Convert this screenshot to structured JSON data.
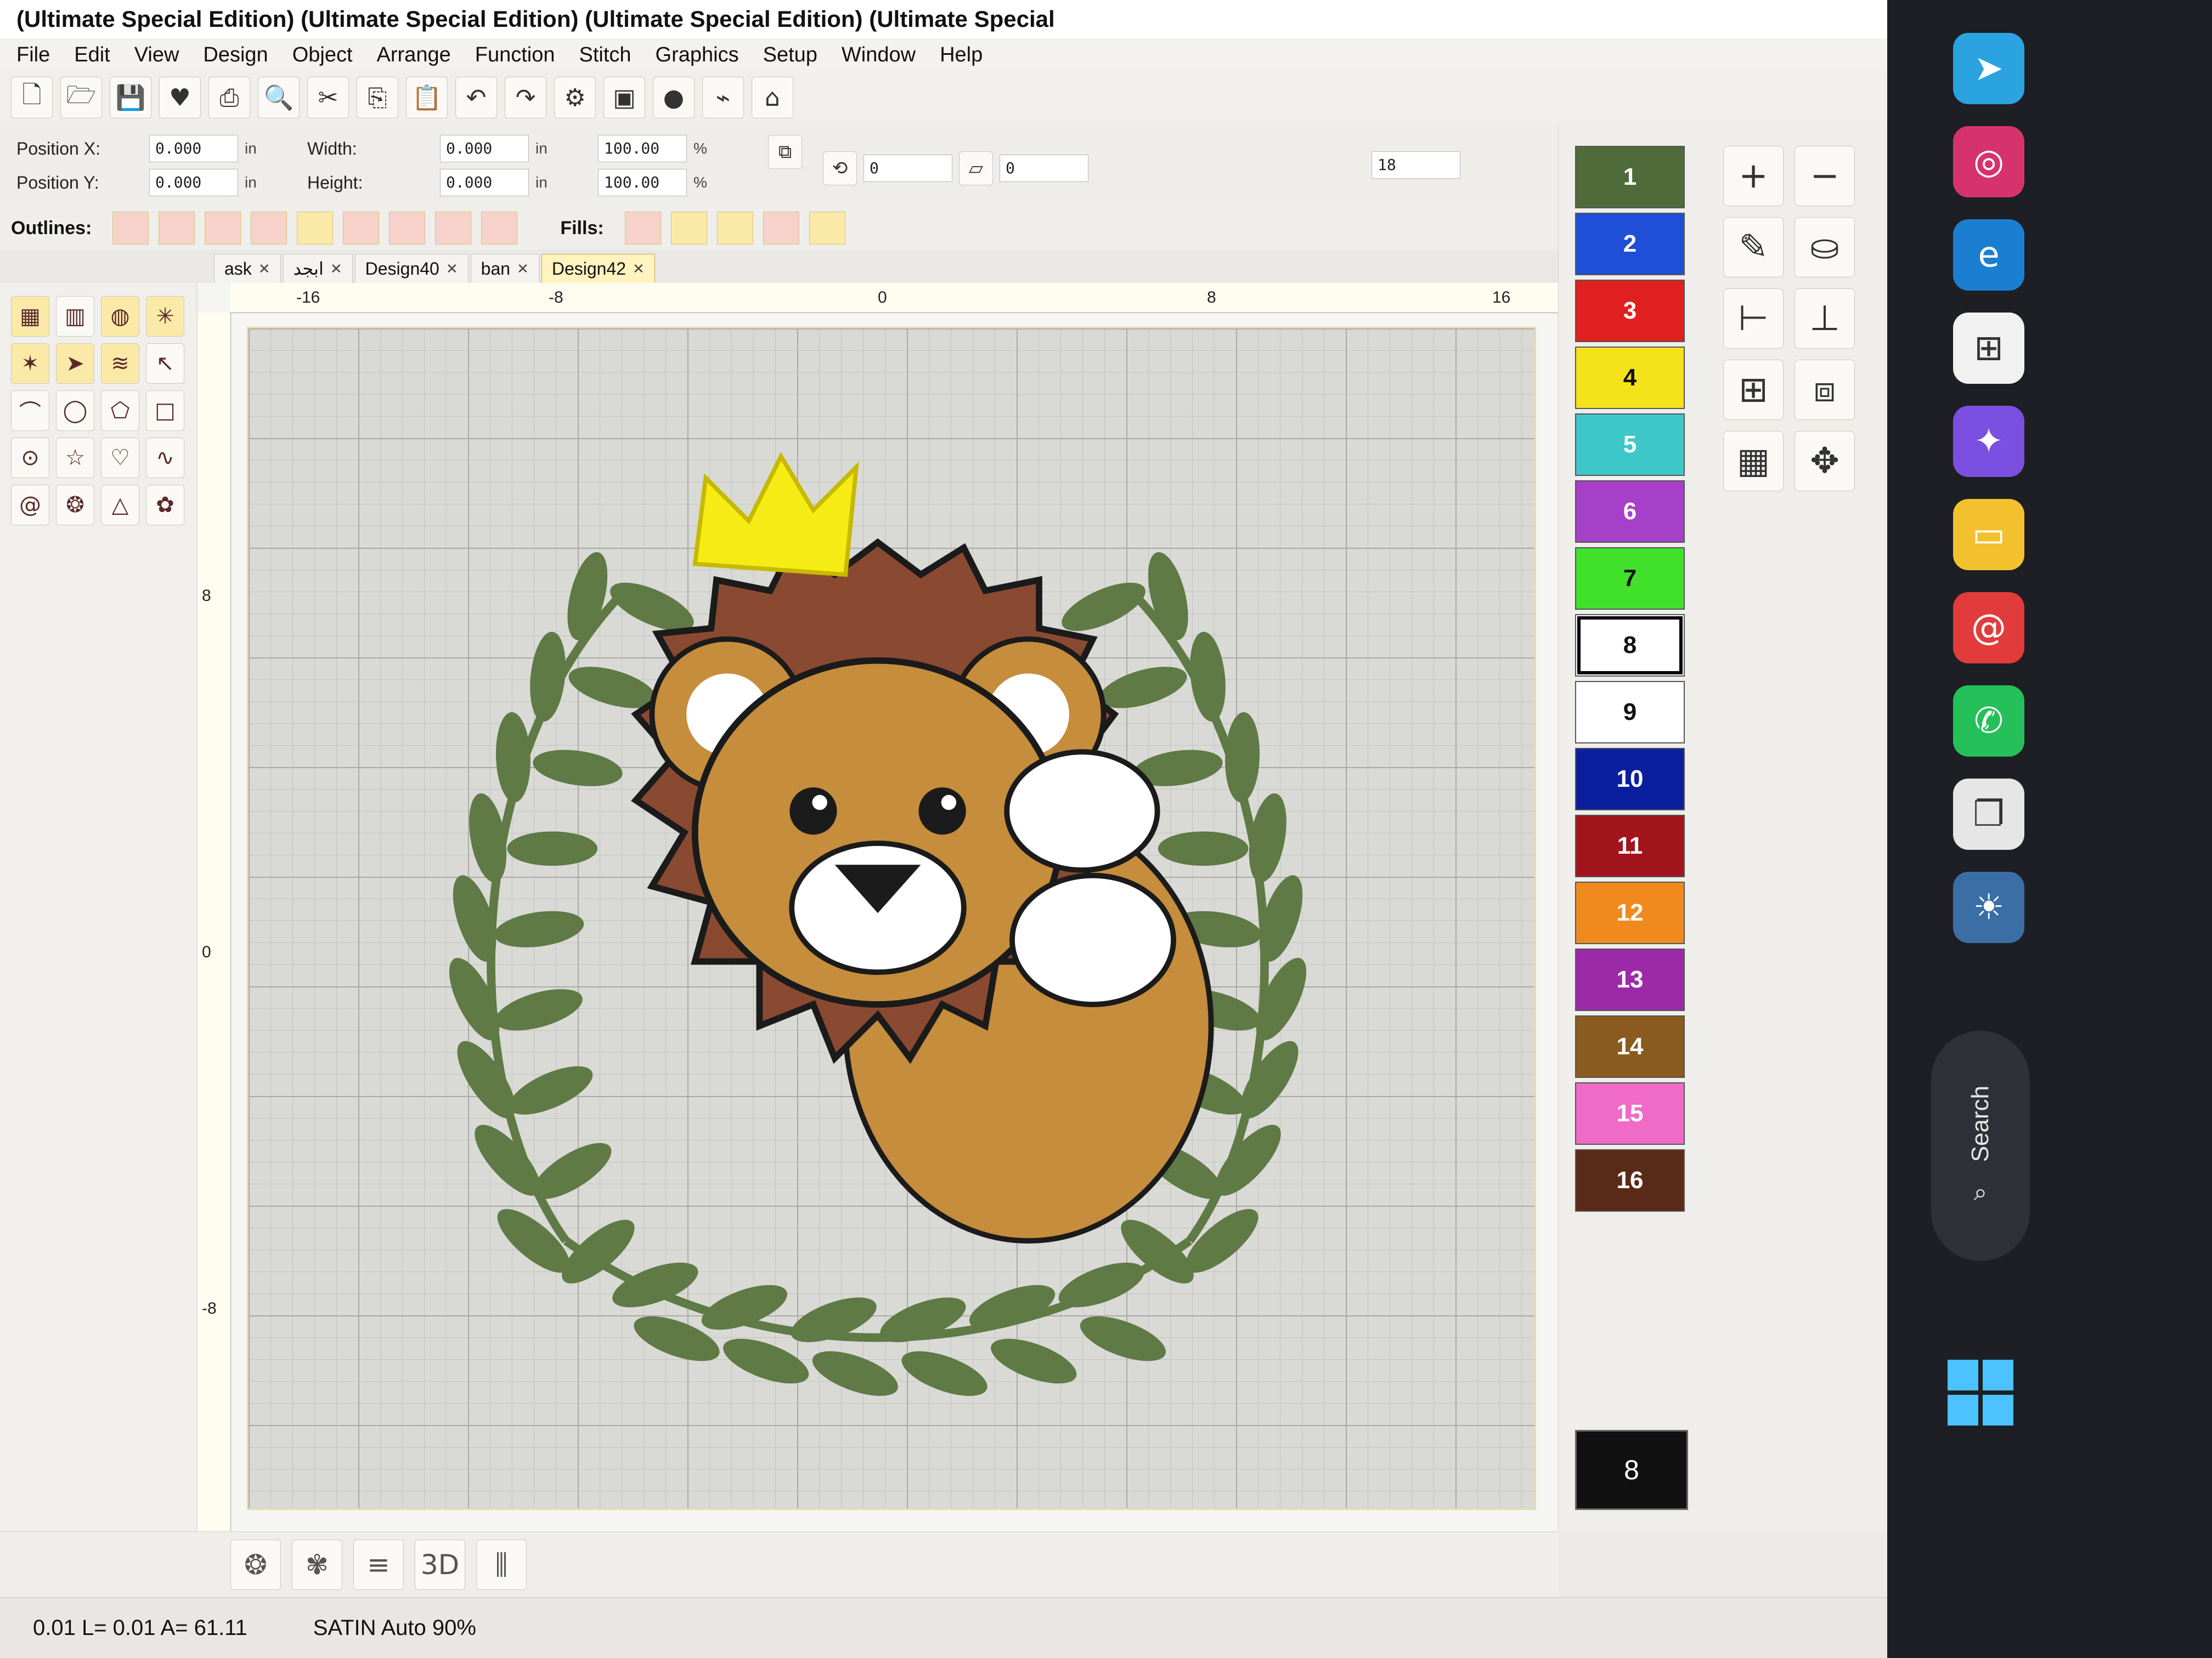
{
  "title": "(Ultimate Special Edition) (Ultimate Special Edition) (Ultimate Special Edition) (Ultimate Special",
  "menu": [
    "File",
    "Edit",
    "View",
    "Design",
    "Object",
    "Arrange",
    "Function",
    "Stitch",
    "Graphics",
    "Setup",
    "Window",
    "Help"
  ],
  "props": {
    "pos_x_label": "Position X:",
    "pos_x": "0.000",
    "pos_x_unit": "in",
    "pos_y_label": "Position Y:",
    "pos_y": "0.000",
    "pos_y_unit": "in",
    "width_label": "Width:",
    "width": "0.000",
    "width_unit": "in",
    "height_label": "Height:",
    "height": "0.000",
    "height_unit": "in",
    "scale_x": "100.00",
    "scale_x_unit": "%",
    "scale_y": "100.00",
    "scale_y_unit": "%",
    "field_a": "0",
    "field_b": "0",
    "field_c": "18"
  },
  "strip": {
    "outlines_label": "Outlines:",
    "fills_label": "Fills:"
  },
  "tabs": [
    {
      "label": "ask",
      "active": false
    },
    {
      "label": "ابجد",
      "active": false
    },
    {
      "label": "Design40",
      "active": false
    },
    {
      "label": "ban",
      "active": false
    },
    {
      "label": "Design42",
      "active": true
    }
  ],
  "ruler_top": [
    "-16",
    "-8",
    "0",
    "8",
    "16"
  ],
  "ruler_left": [
    "8",
    "0",
    "-8"
  ],
  "palette": [
    {
      "n": "1",
      "color": "#4f6b3a"
    },
    {
      "n": "2",
      "color": "#1f4fd8"
    },
    {
      "n": "3",
      "color": "#e02020"
    },
    {
      "n": "4",
      "color": "#f4e21a"
    },
    {
      "n": "5",
      "color": "#3ec7c9"
    },
    {
      "n": "6",
      "color": "#a640c8"
    },
    {
      "n": "7",
      "color": "#41e02b"
    },
    {
      "n": "8",
      "color": "#ffffff"
    },
    {
      "n": "9",
      "color": "#ffffff"
    },
    {
      "n": "10",
      "color": "#0b1f9e"
    },
    {
      "n": "11",
      "color": "#a3151c"
    },
    {
      "n": "12",
      "color": "#f08a1f"
    },
    {
      "n": "13",
      "color": "#9c2aa8"
    },
    {
      "n": "14",
      "color": "#8a5a1f"
    },
    {
      "n": "15",
      "color": "#f06ac8"
    },
    {
      "n": "16",
      "color": "#5a2a18"
    }
  ],
  "current_color_label": "8",
  "status": {
    "coords": "0.01 L= 0.01 A= 61.11",
    "stitch": "SATIN Auto 90%"
  },
  "taskbar": {
    "search": "Search"
  },
  "design_colors": {
    "mane": "#8a4a32",
    "face": "#c58d3c",
    "crown": "#f5ec16",
    "leaf": "#5f7a45",
    "white": "#ffffff",
    "outline": "#1b1b1b"
  }
}
